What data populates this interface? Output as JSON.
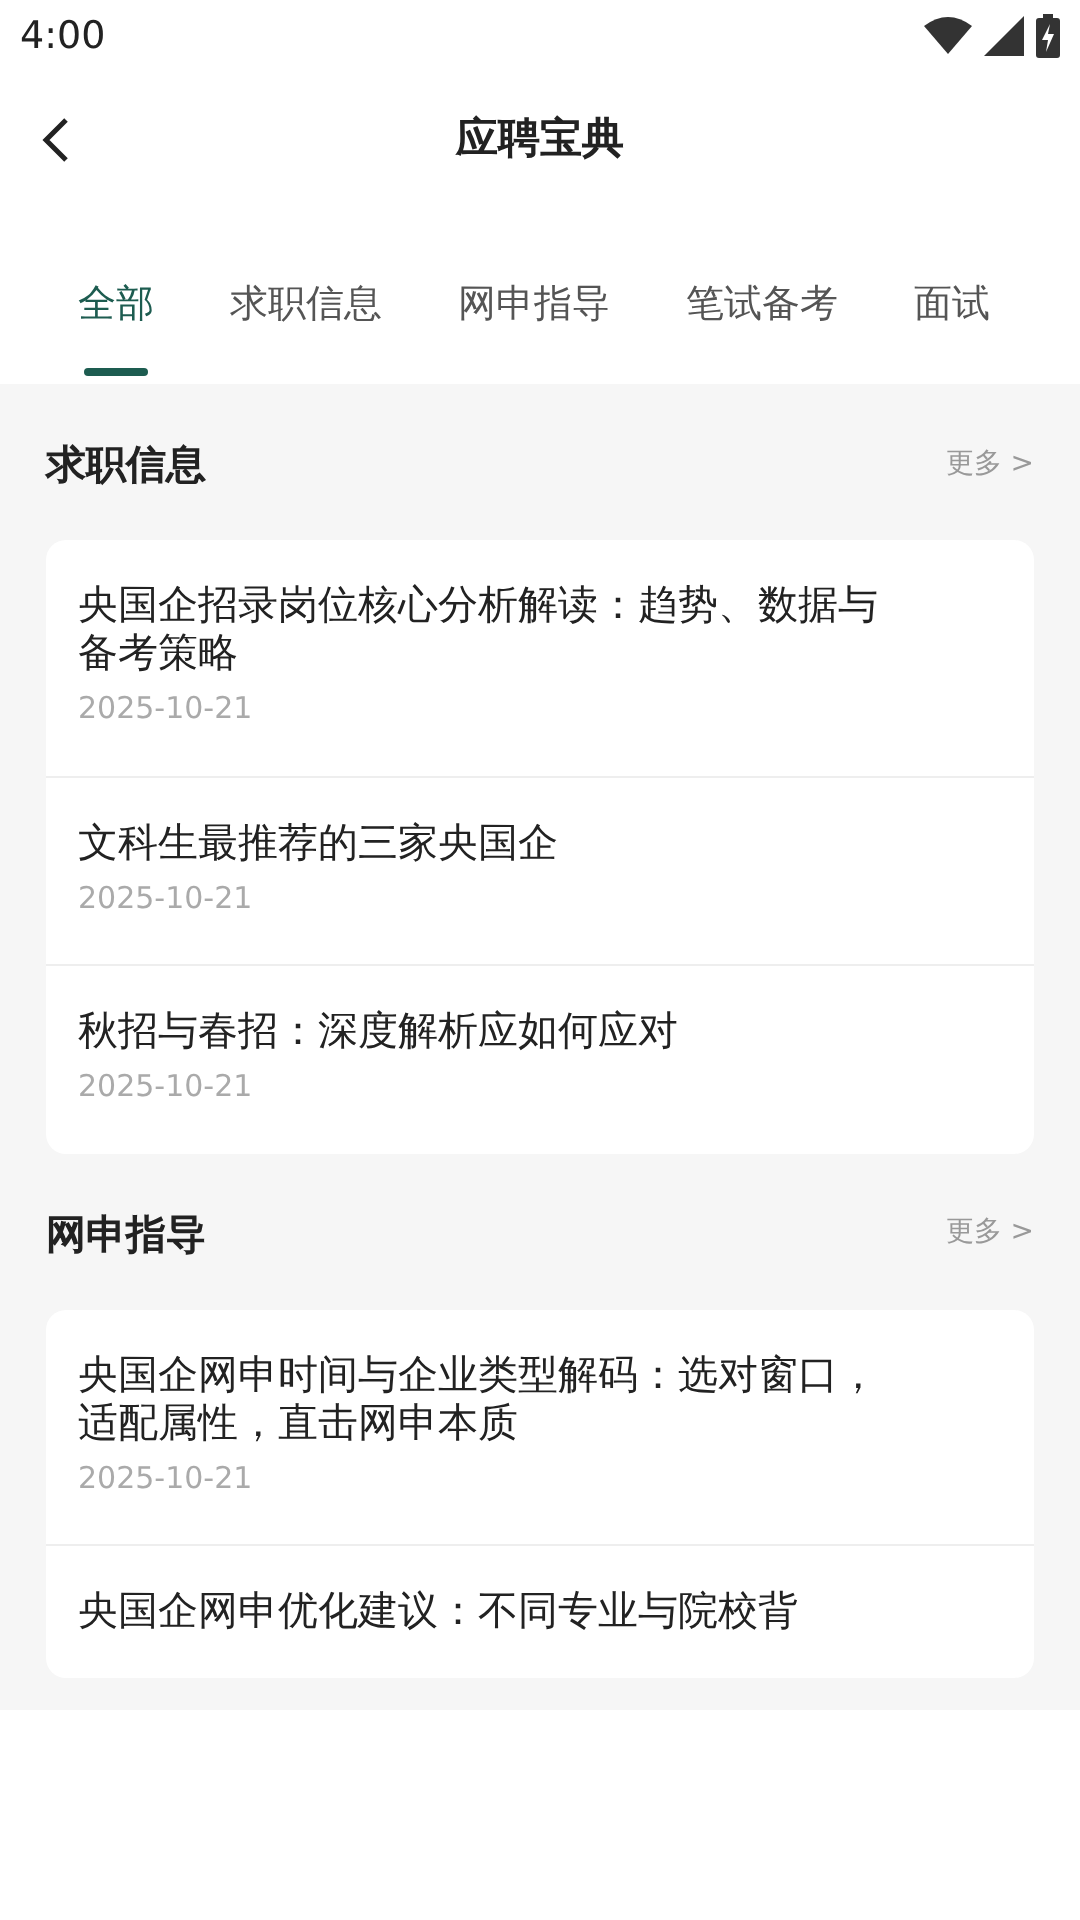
{
  "status_bar": {
    "time": "4:00"
  },
  "header": {
    "title": "应聘宝典"
  },
  "tabs": [
    {
      "label": "全部",
      "selected": true
    },
    {
      "label": "求职信息",
      "selected": false
    },
    {
      "label": "网申指导",
      "selected": false
    },
    {
      "label": "笔试备考",
      "selected": false
    },
    {
      "label": "面试",
      "selected": false
    }
  ],
  "sections": [
    {
      "title": "求职信息",
      "more": "更多 >",
      "articles": [
        {
          "title": "央国企招录岗位核心分析解读：趋势、数据与备考策略",
          "date": "2025-10-21"
        },
        {
          "title": "文科生最推荐的三家央国企",
          "date": "2025-10-21"
        },
        {
          "title": "秋招与春招：深度解析应如何应对",
          "date": "2025-10-21"
        }
      ]
    },
    {
      "title": "网申指导",
      "more": "更多 >",
      "articles": [
        {
          "title": "央国企网申时间与企业类型解码：选对窗口，适配属性，直击网申本质",
          "date": "2025-10-21"
        },
        {
          "title": "央国企网申优化建议：不同专业与院校背"
        }
      ]
    }
  ]
}
